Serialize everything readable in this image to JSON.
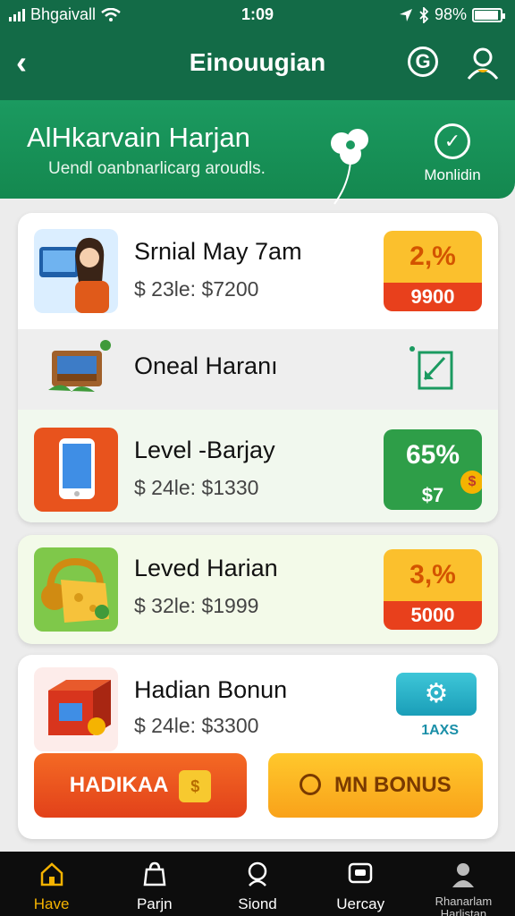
{
  "status": {
    "carrier": "Bhgaivall",
    "time": "1:09",
    "battery": "98%"
  },
  "nav": {
    "back_glyph": "‹",
    "title": "Einouugian",
    "g_glyph": "G"
  },
  "banner": {
    "title": "AlHkarvain Harjan",
    "subtitle": "Uendl oanbnarlicarg aroudls.",
    "monitor_label": "Monlidin"
  },
  "items": [
    {
      "name": "Srnial May 7am",
      "price": "$ 23le: $7200",
      "badge_pct": "2,%",
      "badge_amt": "9900",
      "badge_style": "yellow"
    },
    {
      "name": "Oneal Haranı"
    },
    {
      "name": "Level -Barjay",
      "price": "$ 24le: $1330",
      "badge_pct": "65%",
      "badge_amt": "$7",
      "badge_style": "green"
    },
    {
      "name": "Leved Harian",
      "price": "$ 32le: $1999",
      "badge_pct": "3,%",
      "badge_amt": "5000",
      "badge_style": "yellow"
    },
    {
      "name": "Hadian Bonun",
      "price": "$ 24le: $3300",
      "side_label": "1AXS"
    }
  ],
  "buttons": {
    "primary": "HADIKAA",
    "secondary": "MN BONUS"
  },
  "tabs": [
    {
      "label": "Have",
      "icon": "home-icon",
      "active": true
    },
    {
      "label": "Parjn",
      "icon": "bag-icon"
    },
    {
      "label": "Siond",
      "icon": "search-icon"
    },
    {
      "label": "Uercay",
      "icon": "tv-icon"
    },
    {
      "label": "Rhanarlam Harlistan",
      "icon": "profile-icon"
    }
  ],
  "colors": {
    "header": "#136b47",
    "banner": "#1b9a60",
    "accent_yellow": "#fbc02d",
    "accent_orange": "#e8401c",
    "accent_green": "#2e9e48",
    "tab_active": "#f5b301"
  }
}
